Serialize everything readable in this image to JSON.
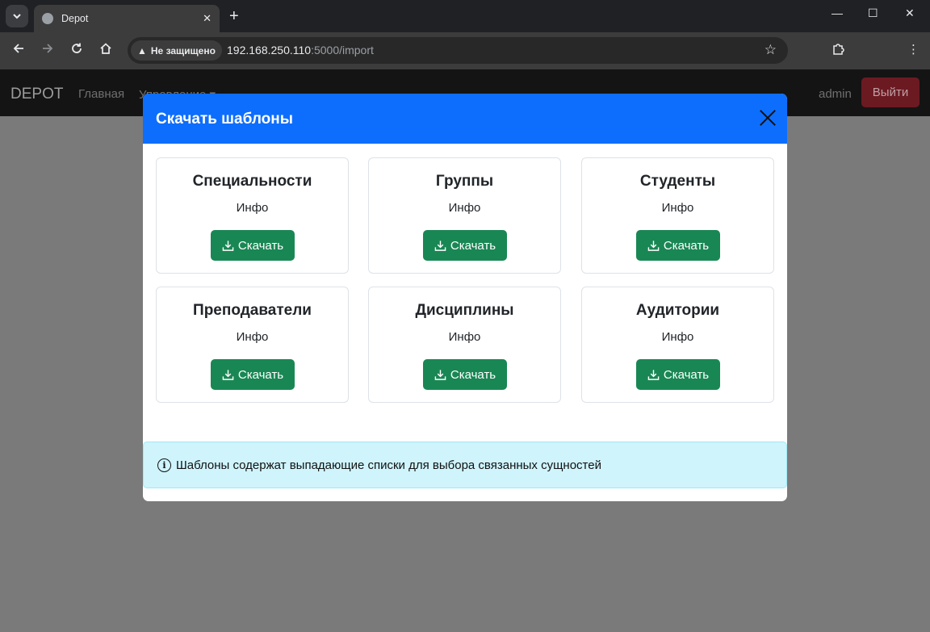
{
  "browser": {
    "tab_title": "Depot",
    "tab_close": "✕",
    "new_tab": "+",
    "security_label": "Не защищено",
    "url_host": "192.168.250.110",
    "url_rest": ":5000/import",
    "window_controls": {
      "minimize": "—",
      "maximize": "☐",
      "close": "✕"
    }
  },
  "navbar": {
    "brand": "DEPOT",
    "links": [
      "Главная",
      "Управление ▾"
    ],
    "user": "admin",
    "logout_label": "Выйти"
  },
  "modal": {
    "title": "Скачать шаблоны",
    "cards": [
      {
        "title": "Специальности",
        "info": "Инфо",
        "button": "Скачать"
      },
      {
        "title": "Группы",
        "info": "Инфо",
        "button": "Скачать"
      },
      {
        "title": "Студенты",
        "info": "Инфо",
        "button": "Скачать"
      },
      {
        "title": "Преподаватели",
        "info": "Инфо",
        "button": "Скачать"
      },
      {
        "title": "Дисциплины",
        "info": "Инфо",
        "button": "Скачать"
      },
      {
        "title": "Аудитории",
        "info": "Инфо",
        "button": "Скачать"
      }
    ],
    "alert_icon": "i",
    "alert_text": "Шаблоны содержат выпадающие списки для выбора связанных сущностей"
  },
  "colors": {
    "header": "#0d6efd",
    "download_button": "#198754",
    "alert_bg": "#cff4fc",
    "logout": "#dc3545"
  },
  "icons": {
    "tab_search": "chevron-down-icon",
    "back": "arrow-left-icon",
    "forward": "arrow-right-icon",
    "reload": "reload-icon",
    "home": "home-icon",
    "bookmark": "star-icon",
    "extensions": "puzzle-icon",
    "menu": "kebab-menu-icon",
    "download": "download-icon",
    "info": "info-circle-icon",
    "close": "close-icon"
  }
}
